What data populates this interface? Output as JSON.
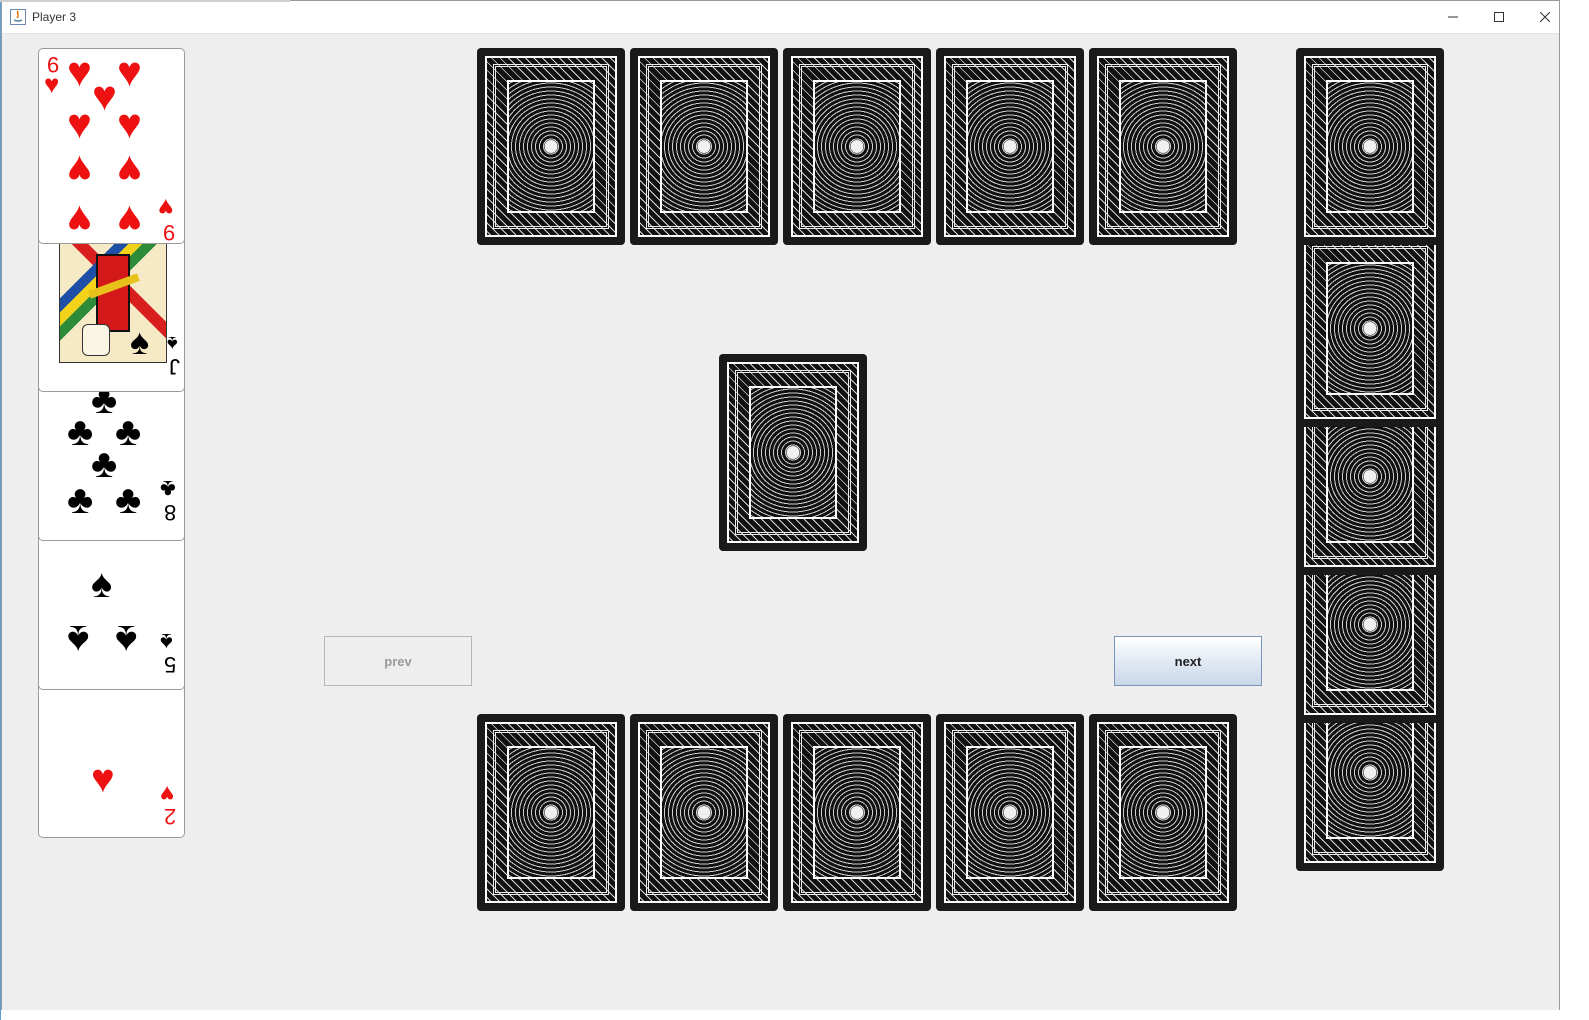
{
  "window": {
    "title": "Player 3",
    "controls": {
      "minimize": "minimize-icon",
      "maximize": "maximize-icon",
      "close": "close-icon"
    }
  },
  "player_hand": {
    "cards": [
      {
        "rank": "9",
        "suit": "hearts"
      },
      {
        "rank": "J",
        "suit": "spades"
      },
      {
        "rank": "8",
        "suit": "clubs"
      },
      {
        "rank": "5",
        "suit": "spades"
      },
      {
        "rank": "2",
        "suit": "hearts"
      }
    ]
  },
  "opponents": {
    "top": {
      "face_down_count": 5
    },
    "bottom": {
      "face_down_count": 5
    },
    "right": {
      "face_down_count": 5
    }
  },
  "center_pile": {
    "face_down_count": 1
  },
  "controls": {
    "prev_label": "prev",
    "next_label": "next",
    "prev_enabled": false,
    "next_enabled": true
  },
  "colors": {
    "red_suit": "#ee1111",
    "black_suit": "#000000",
    "card_back": "#1a1a1a",
    "window_bg": "#eeeeee"
  }
}
